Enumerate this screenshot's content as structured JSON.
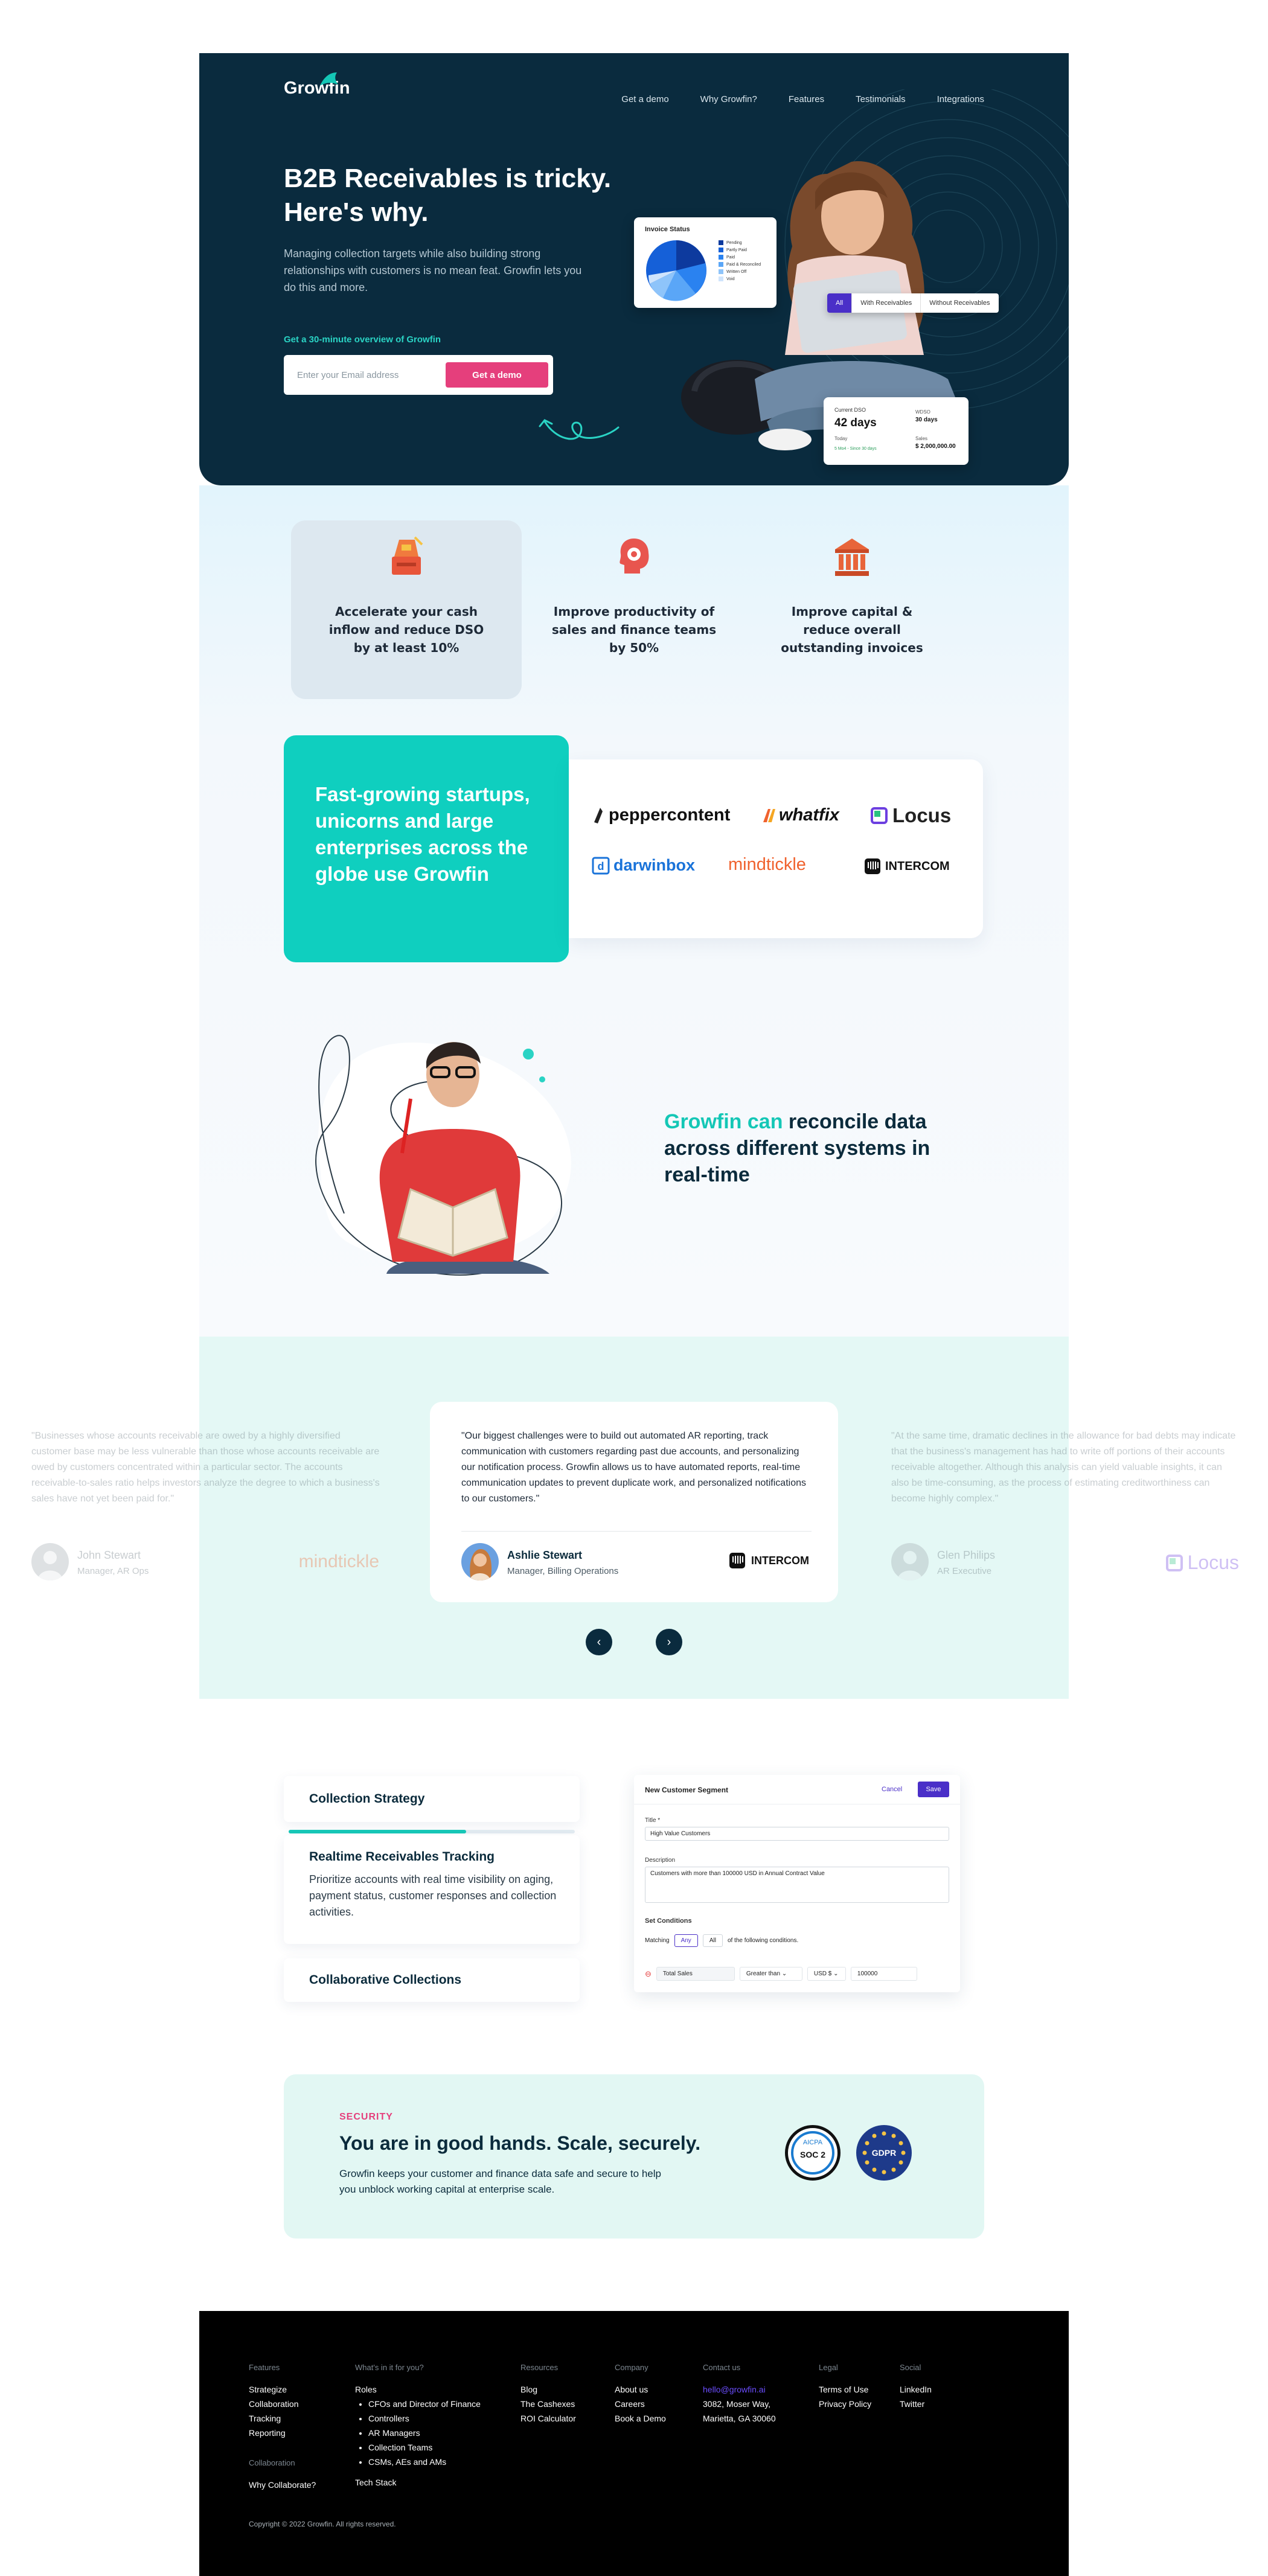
{
  "brand": {
    "name": "Growfin"
  },
  "nav": [
    "Get a demo",
    "Why Growfin?",
    "Features",
    "Testimonials",
    "Integrations"
  ],
  "hero": {
    "title": "B2B Receivables is tricky. Here's why.",
    "subtitle": "Managing collection targets while also building strong relationships with customers is no mean feat. Growfin lets you do this and more.",
    "cta_label": "Get a 30-minute overview of Growfin",
    "email_placeholder": "Enter your Email address",
    "demo_button": "Get a demo"
  },
  "invoice_card": {
    "title": "Invoice Status",
    "legend": [
      "Pending",
      "Partly Paid",
      "Paid",
      "Paid & Reconciled",
      "Written Off",
      "Void"
    ],
    "colors": [
      "#0d3a9e",
      "#1560d8",
      "#2a82f0",
      "#5aa6f7",
      "#8ec4fa",
      "#cfe4fc"
    ]
  },
  "receivables_toggle": [
    "All",
    "With Receivables",
    "Without Receivables"
  ],
  "dso_card": {
    "current_dso_label": "Current DSO",
    "current_dso_value": "42 days",
    "today_label": "Today",
    "change": "5 Mo4 - Since 30 days",
    "wdso_label": "WDSO",
    "wdso_value": "30 days",
    "sales_label": "Sales",
    "sales_value": "$ 2,000,000.00"
  },
  "benefits": [
    {
      "text": "Accelerate your cash inflow and reduce DSO by at least 10%",
      "icon": "cash-register-icon"
    },
    {
      "text": "Improve productivity of sales and finance teams by 50%",
      "icon": "head-gear-icon"
    },
    {
      "text": "Improve capital & reduce overall outstanding invoices",
      "icon": "bank-icon"
    }
  ],
  "customers": {
    "headline": "Fast-growing startups, unicorns and large enterprises across the globe use Growfin",
    "logos": [
      "peppercontent",
      "whatfix",
      "Locus",
      "darwinbox",
      "mindtickle",
      "INTERCOM"
    ]
  },
  "reconcile": {
    "highlight": "Growfin can",
    "rest": " reconcile data across different systems in real-time"
  },
  "testimonials": [
    {
      "quote": "\"Businesses whose accounts receivable are owed by a highly diversified customer base may be less vulnerable than those whose accounts receivable are owed by customers concentrated within a particular sector. The accounts receivable-to-sales ratio helps investors analyze the degree to which a business's sales have not yet been paid for.\"",
      "name": "John Stewart",
      "role": "Manager, AR Ops",
      "company": "mindtickle"
    },
    {
      "quote": "\"Our biggest challenges were to build out automated AR reporting, track communication with customers regarding past due accounts, and personalizing our notification process. Growfin allows us to have automated reports, real-time communication updates to prevent duplicate work, and personalized notifications to our customers.\"",
      "name": "Ashlie Stewart",
      "role": "Manager, Billing Operations",
      "company": "INTERCOM"
    },
    {
      "quote": "\"At the same time, dramatic declines in the allowance for bad debts may indicate that the business's management has had to write off portions of their accounts receivable altogether. Although this analysis can yield valuable insights, it can also be time-consuming, as the process of estimating creditworthiness can become highly complex.\"",
      "name": "Glen Philips",
      "role": "AR Executive",
      "company": "Locus"
    }
  ],
  "collections": [
    {
      "title": "Collection Strategy"
    },
    {
      "title": "Realtime Receivables Tracking",
      "desc": "Prioritize accounts with real time visibility on aging, payment status, customer responses and collection activities."
    },
    {
      "title": "Collaborative Collections"
    }
  ],
  "progress_fraction": 0.62,
  "segment": {
    "header": "New Customer Segment",
    "cancel": "Cancel",
    "save": "Save",
    "title_label": "Title *",
    "title_value": "High Value Customers",
    "desc_label": "Description",
    "desc_value": "Customers with more than 100000 USD in Annual Contract Value",
    "conditions_label": "Set Conditions",
    "matching": "Matching",
    "any": "Any",
    "all": "All",
    "of_following": "of the following conditions.",
    "field": "Total Sales",
    "operator": "Greater than",
    "currency": "USD $",
    "value": "100000"
  },
  "security": {
    "tag": "SECURITY",
    "title": "You are in good hands. Scale, securely.",
    "desc": "Growfin keeps your customer and finance data safe and secure to help you unblock working capital at enterprise scale.",
    "badge1_top": "AICPA",
    "badge1": "SOC 2",
    "badge2": "GDPR"
  },
  "footer": {
    "features": {
      "heading": "Features",
      "items": [
        "Strategize",
        "Collaboration",
        "Tracking",
        "Reporting"
      ]
    },
    "collaboration": {
      "heading": "Collaboration",
      "items": [
        "Why Collaborate?"
      ]
    },
    "whats_in": {
      "heading": "What's in it for you?",
      "roles_label": "Roles",
      "roles": [
        "CFOs and Director of Finance",
        "Controllers",
        "AR Managers",
        "Collection Teams",
        "CSMs, AEs and AMs"
      ],
      "tech": "Tech Stack"
    },
    "resources": {
      "heading": "Resources",
      "items": [
        "Blog",
        "The Cashexes",
        "ROI Calculator"
      ]
    },
    "company": {
      "heading": "Company",
      "items": [
        "About us",
        "Careers",
        "Book a Demo"
      ]
    },
    "contact": {
      "heading": "Contact us",
      "email": "hello@growfin.ai",
      "addr1": "3082, Moser Way,",
      "addr2": "Marietta, GA  30060"
    },
    "legal": {
      "heading": "Legal",
      "items": [
        "Terms of Use",
        "Privacy Policy"
      ]
    },
    "social": {
      "heading": "Social",
      "items": [
        "LinkedIn",
        "Twitter"
      ]
    },
    "copyright": "Copyright © 2022 Growfin. All rights reserved."
  }
}
